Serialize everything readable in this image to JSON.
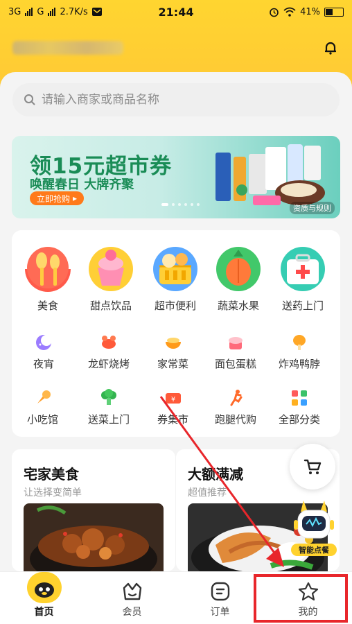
{
  "status_bar": {
    "network_1": "3G",
    "network_2": "G",
    "speed": "2.7K/s",
    "time": "21:44",
    "battery": "41%"
  },
  "header": {
    "bell_icon": "bell-icon"
  },
  "search": {
    "placeholder": "请输入商家或商品名称"
  },
  "banner": {
    "title": "领15元超市券",
    "subtitle": "唤醒春日 大牌齐聚",
    "button": "立即抢购",
    "rule": "资质与规则",
    "page_count": 6,
    "active_page": 1
  },
  "categories_big": [
    {
      "label": "美食",
      "icon": "food-icon"
    },
    {
      "label": "甜点饮品",
      "icon": "dessert-icon"
    },
    {
      "label": "超市便利",
      "icon": "supermarket-icon"
    },
    {
      "label": "蔬菜水果",
      "icon": "vegetable-icon"
    },
    {
      "label": "送药上门",
      "icon": "medicine-icon"
    }
  ],
  "categories_row2": [
    {
      "label": "夜宵",
      "icon": "moon-icon"
    },
    {
      "label": "龙虾烧烤",
      "icon": "crayfish-icon"
    },
    {
      "label": "家常菜",
      "icon": "bowl-icon"
    },
    {
      "label": "面包蛋糕",
      "icon": "cake-icon"
    },
    {
      "label": "炸鸡鸭脖",
      "icon": "drumstick-icon"
    }
  ],
  "categories_row3": [
    {
      "label": "小吃馆",
      "icon": "snack-icon"
    },
    {
      "label": "送菜上门",
      "icon": "broccoli-icon"
    },
    {
      "label": "券集市",
      "icon": "coupon-icon"
    },
    {
      "label": "跑腿代购",
      "icon": "runner-icon"
    },
    {
      "label": "全部分类",
      "icon": "grid-icon"
    }
  ],
  "feed": {
    "left": {
      "title": "宅家美食",
      "subtitle": "让选择变简单"
    },
    "right": {
      "title": "大额满减",
      "subtitle": "超值推荐"
    }
  },
  "floating": {
    "cart_icon": "cart-icon",
    "robot_label": "智能点餐"
  },
  "bottom_nav": [
    {
      "label": "首页",
      "icon": "home-icon",
      "active": true
    },
    {
      "label": "会员",
      "icon": "member-icon",
      "active": false
    },
    {
      "label": "订单",
      "icon": "order-icon",
      "active": false
    },
    {
      "label": "我的",
      "icon": "profile-icon",
      "active": false
    }
  ],
  "colors": {
    "brand_yellow": "#ffd22e",
    "annotation_red": "#e8262b"
  }
}
